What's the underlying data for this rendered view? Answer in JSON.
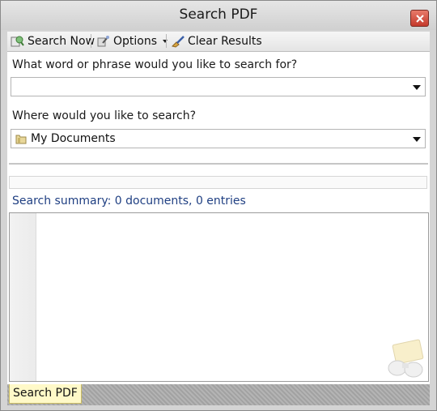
{
  "window": {
    "title": "Search PDF"
  },
  "toolbar": {
    "search_now": "Search Now",
    "options": "Options",
    "clear_results": "Clear Results"
  },
  "search": {
    "phrase_label": "What word or phrase would you like to search for?",
    "phrase_value": "",
    "location_label": "Where would you like to search?",
    "location_value": "My Documents"
  },
  "summary": "Search summary: 0 documents, 0 entries",
  "tabs": {
    "active": "Search PDF"
  },
  "colors": {
    "summary_text": "#1f3f82",
    "close_button": "#c4392b",
    "tab_bg": "#fff9c8"
  }
}
